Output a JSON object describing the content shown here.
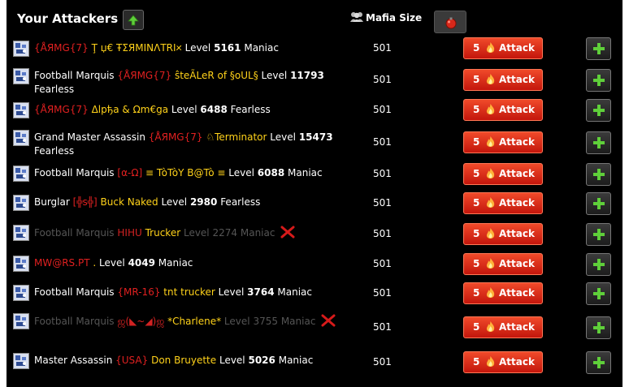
{
  "header": {
    "title": "Your Attackers",
    "mafia_size_label": "Mafia Size"
  },
  "rows": [
    {
      "title": "",
      "tag": "{ÅЯMG{7}",
      "name": "Ţ џ€ ŦΣЯΜINΛTRI🞪",
      "level_label": "Level",
      "level": "5161",
      "type": "Maniac",
      "size": "501",
      "attack_count": "5",
      "attack_label": "Attack",
      "dead": false
    },
    {
      "title": "Football Marquis",
      "tag": "{ÅЯMG{7}",
      "name": "ŝteÃLeR of §oUL§",
      "level_label": "Level",
      "level": "11793",
      "type": "Fearless",
      "size": "501",
      "attack_count": "5",
      "attack_label": "Attack",
      "dead": false
    },
    {
      "title": "",
      "tag": "{ÅЯMG{7}",
      "name": "Δlpђa & Ωm€ga",
      "level_label": "Level",
      "level": "6488",
      "type": "Fearless",
      "size": "501",
      "attack_count": "5",
      "attack_label": "Attack",
      "dead": false
    },
    {
      "title": "Grand Master Assassin",
      "tag": "{ÅЯMG{7}",
      "name": "♘Terminator",
      "level_label": "Level",
      "level": "15473",
      "type": "Fearless",
      "size": "501",
      "attack_count": "5",
      "attack_label": "Attack",
      "dead": false
    },
    {
      "title": "Football Marquis",
      "tag": "[α-Ω]",
      "name": "≡ TòTòY B@Tò ≡",
      "level_label": "Level",
      "level": "6088",
      "type": "Maniac",
      "size": "501",
      "attack_count": "5",
      "attack_label": "Attack",
      "dead": false
    },
    {
      "title": "Burglar",
      "tag": "[╬ѕ╬]",
      "name": "Buck Naked",
      "level_label": "Level",
      "level": "2980",
      "type": "Fearless",
      "size": "501",
      "attack_count": "5",
      "attack_label": "Attack",
      "dead": false
    },
    {
      "title": "Football Marquis",
      "tag": "HIHU",
      "name": "Trucker",
      "level_label": "Level",
      "level": "2274",
      "type": "Maniac",
      "size": "501",
      "attack_count": "5",
      "attack_label": "Attack",
      "dead": true
    },
    {
      "title": "",
      "tag": "MW@RS.PT",
      "name": ".",
      "level_label": "Level",
      "level": "4049",
      "type": "Maniac",
      "size": "501",
      "attack_count": "5",
      "attack_label": "Attack",
      "dead": false
    },
    {
      "title": "Football Marquis",
      "tag": "{MR-16}",
      "name": "tnt trucker",
      "level_label": "Level",
      "level": "3764",
      "type": "Maniac",
      "size": "501",
      "attack_count": "5",
      "attack_label": "Attack",
      "dead": false
    },
    {
      "title": "Football Marquis",
      "tag": "ஜ(◣~◢)ஜ",
      "name": "*Charlene*",
      "level_label": "Level",
      "level": "3755",
      "type": "Maniac",
      "size": "501",
      "attack_count": "5",
      "attack_label": "Attack",
      "dead": true
    },
    {
      "title": "Master Assassin",
      "tag": "{USA}",
      "name": "Don Bruyette",
      "level_label": "Level",
      "level": "5026",
      "type": "Maniac",
      "size": "501",
      "attack_count": "5",
      "attack_label": "Attack",
      "dead": false
    }
  ],
  "icons": {
    "sort": "up-arrow-icon",
    "mafia": "mafia-group-icon",
    "bomb": "bomb-icon",
    "attack": "flame-icon",
    "add": "plus-icon",
    "dead": "x-mark-icon",
    "avatar": "player-avatar-icon"
  },
  "colors": {
    "tag": "#e02020",
    "name": "#ffd21a",
    "attack_button": "#d8200f",
    "add_icon": "#5fcf3a"
  }
}
